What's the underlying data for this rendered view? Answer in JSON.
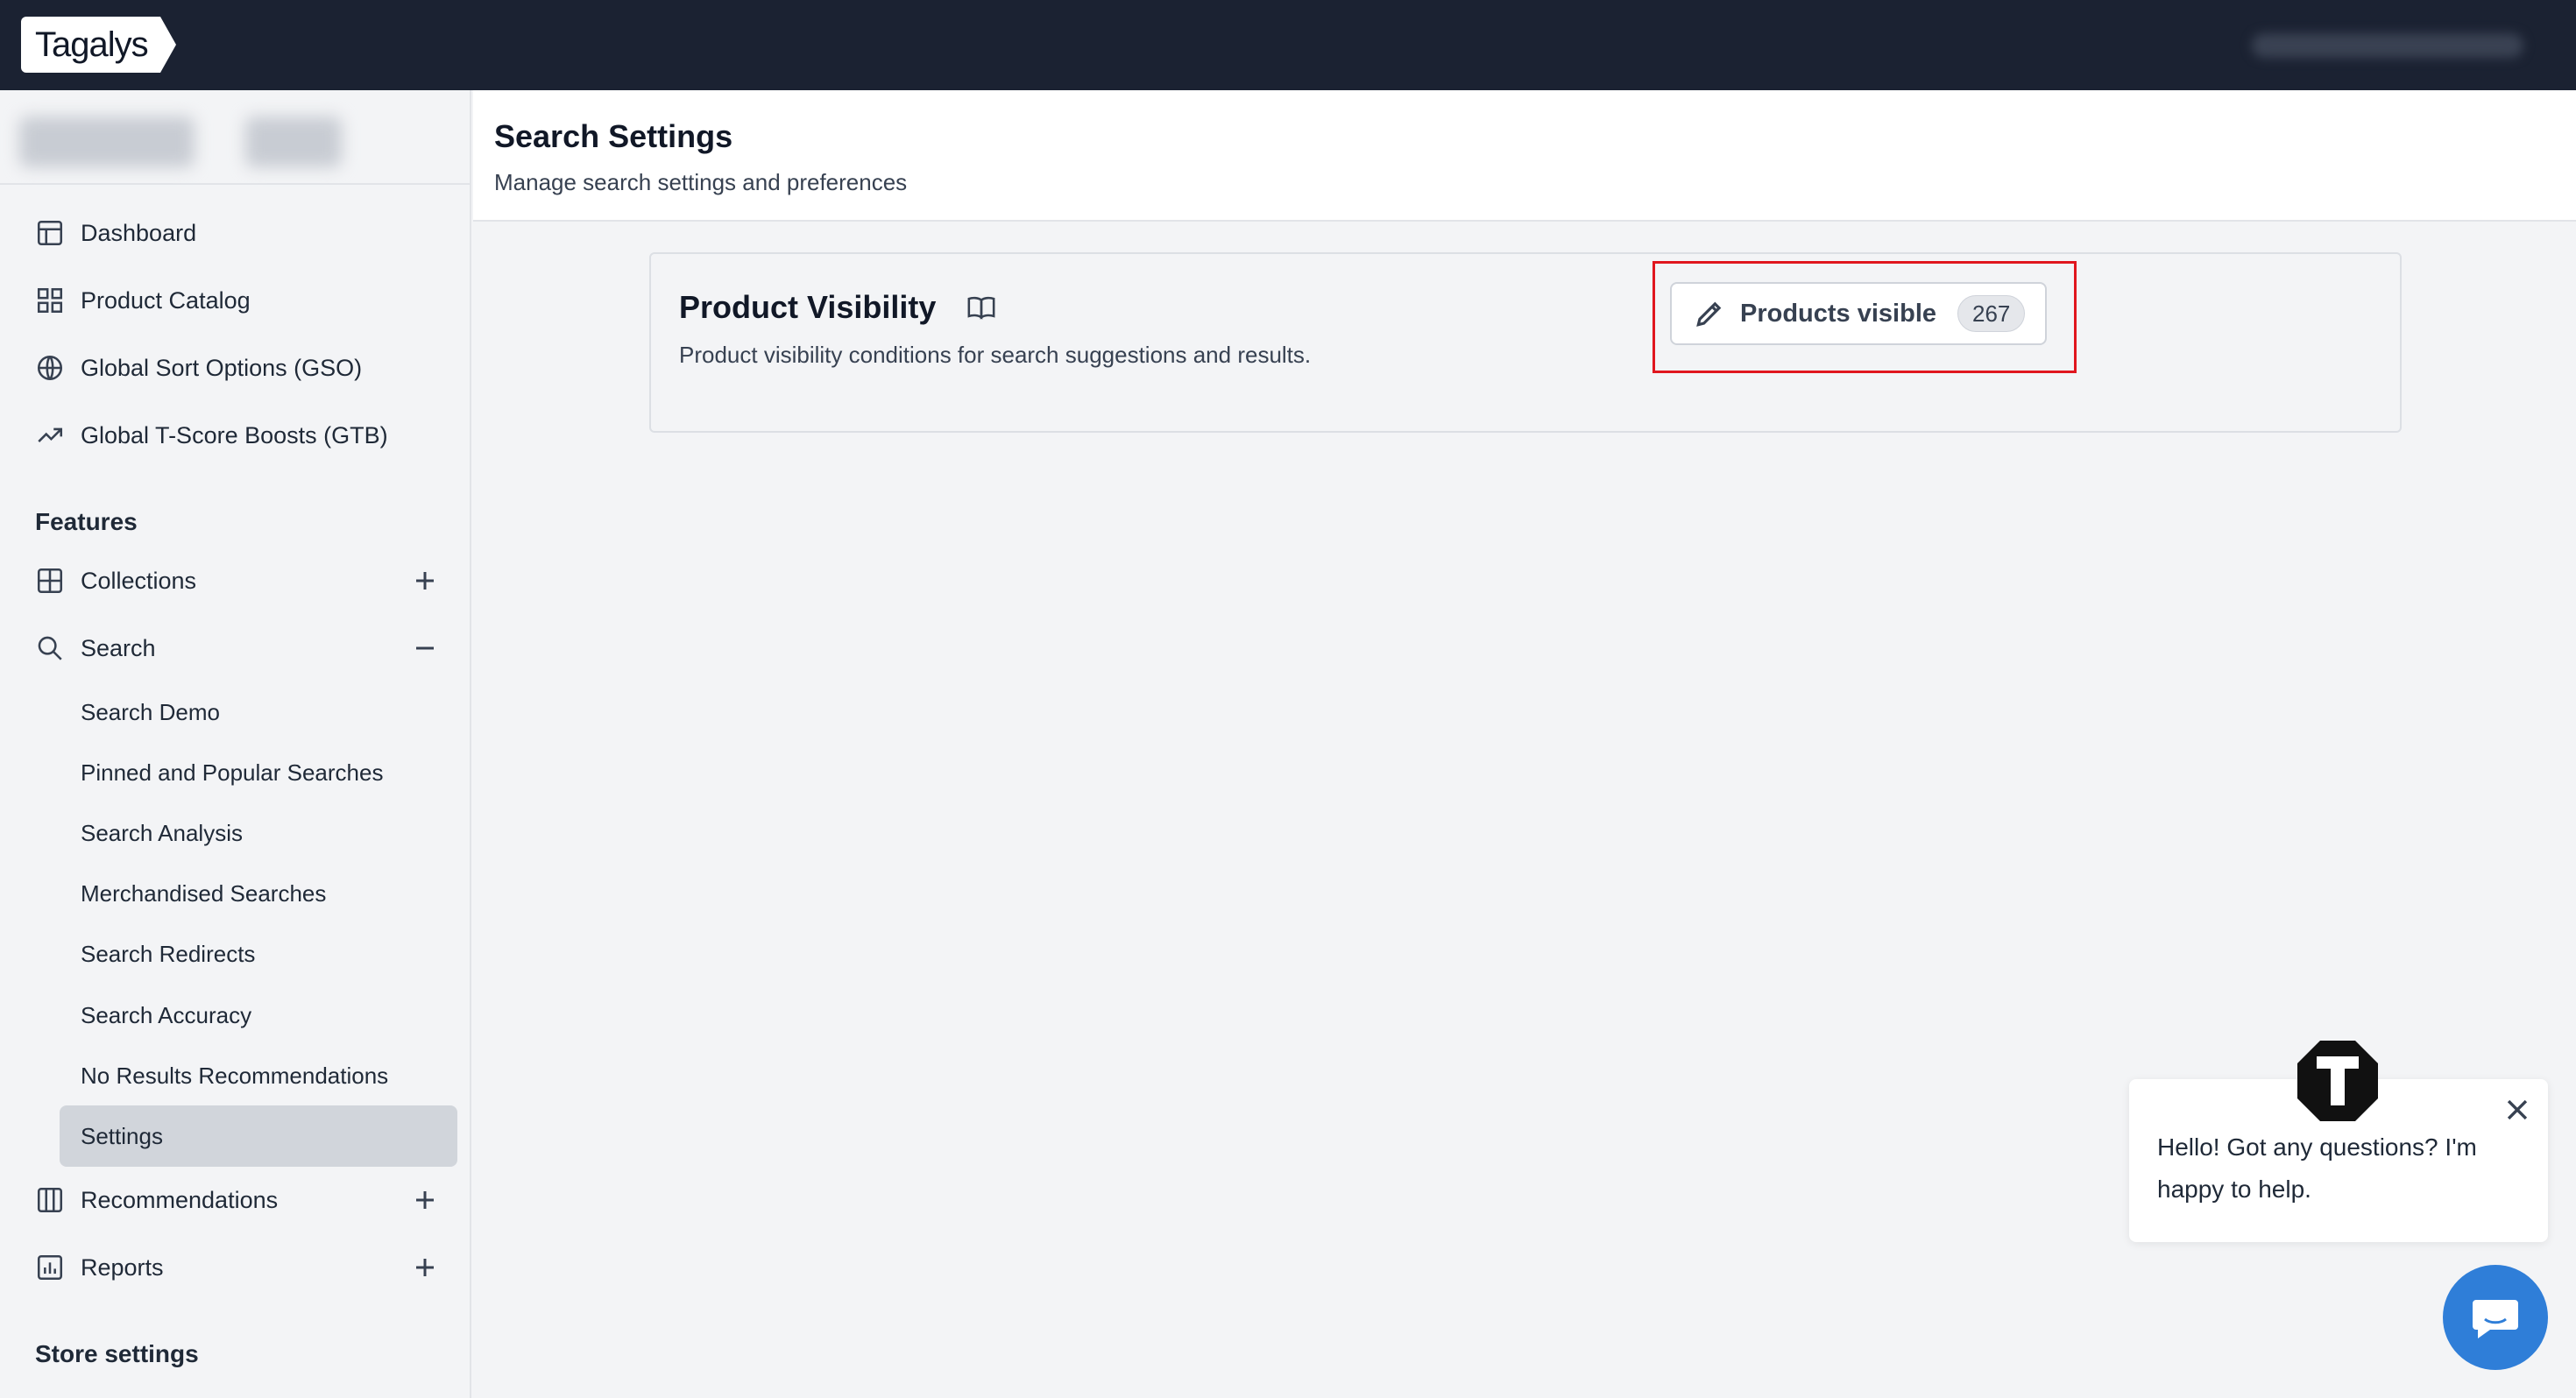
{
  "app": {
    "logo_text": "Tagalys"
  },
  "sidebar": {
    "top_items": [
      {
        "label": "Dashboard",
        "icon": "dashboard-icon"
      },
      {
        "label": "Product Catalog",
        "icon": "grid-icon"
      },
      {
        "label": "Global Sort Options (GSO)",
        "icon": "globe-icon"
      },
      {
        "label": "Global T-Score Boosts (GTB)",
        "icon": "trending-up-icon"
      }
    ],
    "features_title": "Features",
    "features": [
      {
        "label": "Collections",
        "icon": "collections-icon",
        "state": "collapsed"
      },
      {
        "label": "Search",
        "icon": "search-icon",
        "state": "expanded"
      },
      {
        "label": "Recommendations",
        "icon": "columns-icon",
        "state": "collapsed"
      },
      {
        "label": "Reports",
        "icon": "chart-icon",
        "state": "collapsed"
      }
    ],
    "search_sub_items": [
      "Search Demo",
      "Pinned and Popular Searches",
      "Search Analysis",
      "Merchandised Searches",
      "Search Redirects",
      "Search Accuracy",
      "No Results Recommendations",
      "Settings"
    ],
    "active_sub_item": "Settings",
    "store_settings_title": "Store settings"
  },
  "main": {
    "title": "Search Settings",
    "subtitle": "Manage search settings and preferences",
    "card": {
      "title": "Product Visibility",
      "description": "Product visibility conditions for search suggestions and results.",
      "button_label": "Products visible",
      "button_count": "267"
    }
  },
  "chat": {
    "message": "Hello! Got any questions? I'm happy to help."
  },
  "colors": {
    "topbar": "#1b2232",
    "highlight": "#e0161e",
    "chat_launcher": "#2f7ed8"
  }
}
